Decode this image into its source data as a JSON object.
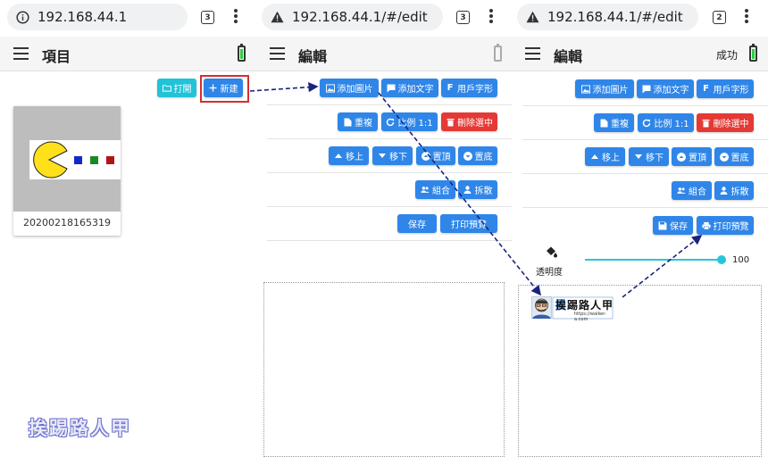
{
  "panels": [
    {
      "url": "192.168.44.1",
      "tab_count": "3",
      "toolbar_title": "項目",
      "buttons": {
        "open": "打開",
        "new": "新建"
      },
      "project": {
        "name": "20200218165319"
      }
    },
    {
      "url": "192.168.44.1/#/edit",
      "tab_count": "3",
      "toolbar_title": "編輯",
      "buttons": {
        "add_image": "添加圖片",
        "add_text": "添加文字",
        "user_font": "用戶字形",
        "duplicate": "重複",
        "ratio": "比例 1:1",
        "delete": "刪除選中",
        "move_up": "移上",
        "move_down": "移下",
        "to_top": "置頂",
        "to_bottom": "置底",
        "group": "組合",
        "ungroup": "拆散",
        "save": "保存",
        "print_preview": "打印預覽"
      }
    },
    {
      "url": "192.168.44.1/#/edit",
      "tab_count": "2",
      "toolbar_title": "編輯",
      "status": "成功",
      "buttons": {
        "add_image": "添加圖片",
        "add_text": "添加文字",
        "user_font": "用戶字形",
        "duplicate": "重複",
        "ratio": "比例 1:1",
        "delete": "刪除選中",
        "move_up": "移上",
        "move_down": "移下",
        "to_top": "置頂",
        "to_bottom": "置底",
        "group": "組合",
        "ungroup": "拆散",
        "save": "保存",
        "print_preview": "打印預覽"
      },
      "opacity": {
        "label": "透明度",
        "value": "100"
      },
      "logo": {
        "text": "挨踢路人甲",
        "url": "https://walker-a.com"
      }
    }
  ],
  "watermark": "挨踢路人甲",
  "colors": {
    "primary": "#2f86e8",
    "danger": "#e53935",
    "accent": "#22c3d8",
    "annotation": "#1a237e",
    "highlight": "#d32f2f"
  }
}
